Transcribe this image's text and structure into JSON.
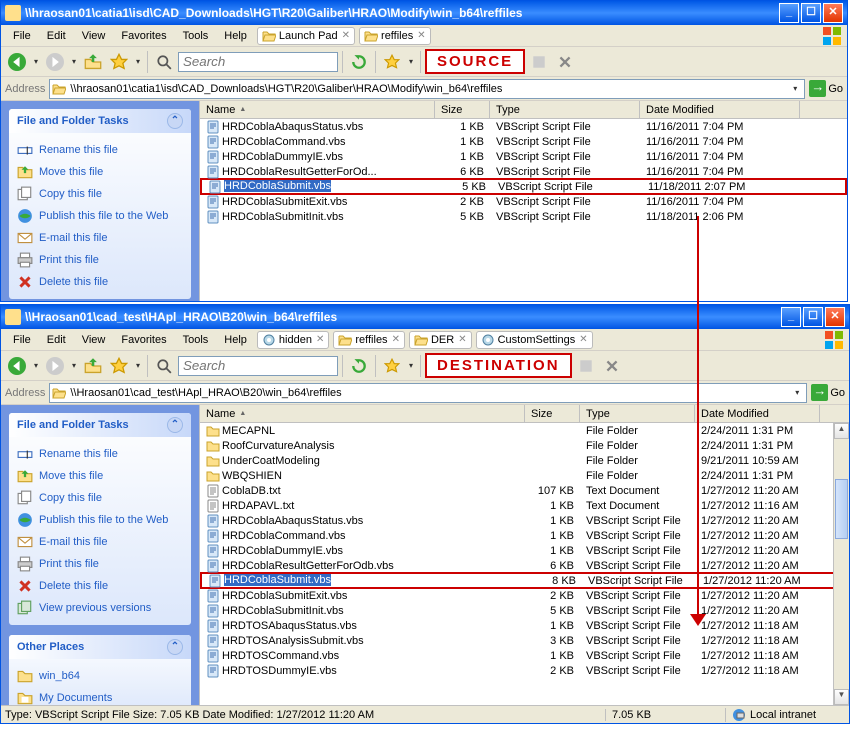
{
  "annotation_source": "SOURCE",
  "annotation_dest": "DESTINATION",
  "top_window": {
    "title": "\\\\hraosan01\\catia1\\isd\\CAD_Downloads\\HGT\\R20\\Galiber\\HRAO\\Modify\\win_b64\\reffiles",
    "menubar": [
      "File",
      "Edit",
      "View",
      "Favorites",
      "Tools",
      "Help"
    ],
    "tabs": [
      {
        "label": "Launch Pad",
        "icon": "folder"
      },
      {
        "label": "reffiles",
        "icon": "folder"
      }
    ],
    "search_placeholder": "Search",
    "address_label": "Address",
    "address_path": "\\\\hraosan01\\catia1\\isd\\CAD_Downloads\\HGT\\R20\\Galiber\\HRAO\\Modify\\win_b64\\reffiles",
    "go_label": "Go",
    "sidebar_title": "File and Folder Tasks",
    "sidebar_tasks": [
      {
        "icon": "rename",
        "label": "Rename this file"
      },
      {
        "icon": "move",
        "label": "Move this file"
      },
      {
        "icon": "copy",
        "label": "Copy this file"
      },
      {
        "icon": "publish",
        "label": "Publish this file to the Web"
      },
      {
        "icon": "email",
        "label": "E-mail this file"
      },
      {
        "icon": "print",
        "label": "Print this file"
      },
      {
        "icon": "delete",
        "label": "Delete this file"
      }
    ],
    "columns": [
      "Name",
      "Size",
      "Type",
      "Date Modified"
    ],
    "files": [
      {
        "name": "HRDCoblaAbaqusStatus.vbs",
        "size": "1 KB",
        "type": "VBScript Script File",
        "date": "11/16/2011 7:04 PM",
        "icon": "vbs",
        "sel": false
      },
      {
        "name": "HRDCoblaCommand.vbs",
        "size": "1 KB",
        "type": "VBScript Script File",
        "date": "11/16/2011 7:04 PM",
        "icon": "vbs",
        "sel": false
      },
      {
        "name": "HRDCoblaDummyIE.vbs",
        "size": "1 KB",
        "type": "VBScript Script File",
        "date": "11/16/2011 7:04 PM",
        "icon": "vbs",
        "sel": false
      },
      {
        "name": "HRDCoblaResultGetterForOd...",
        "size": "6 KB",
        "type": "VBScript Script File",
        "date": "11/16/2011 7:04 PM",
        "icon": "vbs",
        "sel": false
      },
      {
        "name": "HRDCoblaSubmit.vbs",
        "size": "5 KB",
        "type": "VBScript Script File",
        "date": "11/18/2011 2:07 PM",
        "icon": "vbs",
        "sel": true,
        "hl": true
      },
      {
        "name": "HRDCoblaSubmitExit.vbs",
        "size": "2 KB",
        "type": "VBScript Script File",
        "date": "11/16/2011 7:04 PM",
        "icon": "vbs",
        "sel": false
      },
      {
        "name": "HRDCoblaSubmitInit.vbs",
        "size": "5 KB",
        "type": "VBScript Script File",
        "date": "11/18/2011 2:06 PM",
        "icon": "vbs",
        "sel": false
      }
    ]
  },
  "bottom_window": {
    "title": "\\\\Hraosan01\\cad_test\\HApl_HRAO\\B20\\win_b64\\reffiles",
    "menubar": [
      "File",
      "Edit",
      "View",
      "Favorites",
      "Tools",
      "Help"
    ],
    "tabs": [
      {
        "label": "hidden",
        "icon": "gear"
      },
      {
        "label": "reffiles",
        "icon": "folder"
      },
      {
        "label": "DER",
        "icon": "folder"
      },
      {
        "label": "CustomSettings",
        "icon": "gear"
      }
    ],
    "search_placeholder": "Search",
    "address_label": "Address",
    "address_path": "\\\\Hraosan01\\cad_test\\HApl_HRAO\\B20\\win_b64\\reffiles",
    "go_label": "Go",
    "sidebar_title": "File and Folder Tasks",
    "sidebar_tasks": [
      {
        "icon": "rename",
        "label": "Rename this file"
      },
      {
        "icon": "move",
        "label": "Move this file"
      },
      {
        "icon": "copy",
        "label": "Copy this file"
      },
      {
        "icon": "publish",
        "label": "Publish this file to the Web"
      },
      {
        "icon": "email",
        "label": "E-mail this file"
      },
      {
        "icon": "print",
        "label": "Print this file"
      },
      {
        "icon": "delete",
        "label": "Delete this file"
      },
      {
        "icon": "versions",
        "label": "View previous versions"
      }
    ],
    "sidebar2_title": "Other Places",
    "sidebar2_items": [
      {
        "icon": "folder",
        "label": "win_b64"
      },
      {
        "icon": "docs",
        "label": "My Documents"
      }
    ],
    "columns": [
      "Name",
      "Size",
      "Type",
      "Date Modified"
    ],
    "files": [
      {
        "name": "MECAPNL",
        "size": "",
        "type": "File Folder",
        "date": "2/24/2011 1:31 PM",
        "icon": "folder",
        "sel": false
      },
      {
        "name": "RoofCurvatureAnalysis",
        "size": "",
        "type": "File Folder",
        "date": "2/24/2011 1:31 PM",
        "icon": "folder",
        "sel": false
      },
      {
        "name": "UnderCoatModeling",
        "size": "",
        "type": "File Folder",
        "date": "9/21/2011 10:59 AM",
        "icon": "folder",
        "sel": false
      },
      {
        "name": "WBQSHIEN",
        "size": "",
        "type": "File Folder",
        "date": "2/24/2011 1:31 PM",
        "icon": "folder",
        "sel": false
      },
      {
        "name": "CoblaDB.txt",
        "size": "107 KB",
        "type": "Text Document",
        "date": "1/27/2012 11:20 AM",
        "icon": "txt",
        "sel": false
      },
      {
        "name": "HRDAPAVL.txt",
        "size": "1 KB",
        "type": "Text Document",
        "date": "1/27/2012 11:16 AM",
        "icon": "txt",
        "sel": false
      },
      {
        "name": "HRDCoblaAbaqusStatus.vbs",
        "size": "1 KB",
        "type": "VBScript Script File",
        "date": "1/27/2012 11:20 AM",
        "icon": "vbs",
        "sel": false
      },
      {
        "name": "HRDCoblaCommand.vbs",
        "size": "1 KB",
        "type": "VBScript Script File",
        "date": "1/27/2012 11:20 AM",
        "icon": "vbs",
        "sel": false
      },
      {
        "name": "HRDCoblaDummyIE.vbs",
        "size": "1 KB",
        "type": "VBScript Script File",
        "date": "1/27/2012 11:20 AM",
        "icon": "vbs",
        "sel": false
      },
      {
        "name": "HRDCoblaResultGetterForOdb.vbs",
        "size": "6 KB",
        "type": "VBScript Script File",
        "date": "1/27/2012 11:20 AM",
        "icon": "vbs",
        "sel": false
      },
      {
        "name": "HRDCoblaSubmit.vbs",
        "size": "8 KB",
        "type": "VBScript Script File",
        "date": "1/27/2012 11:20 AM",
        "icon": "vbs",
        "sel": true,
        "hl": true
      },
      {
        "name": "HRDCoblaSubmitExit.vbs",
        "size": "2 KB",
        "type": "VBScript Script File",
        "date": "1/27/2012 11:20 AM",
        "icon": "vbs",
        "sel": false
      },
      {
        "name": "HRDCoblaSubmitInit.vbs",
        "size": "5 KB",
        "type": "VBScript Script File",
        "date": "1/27/2012 11:20 AM",
        "icon": "vbs",
        "sel": false
      },
      {
        "name": "HRDTOSAbaqusStatus.vbs",
        "size": "1 KB",
        "type": "VBScript Script File",
        "date": "1/27/2012 11:18 AM",
        "icon": "vbs",
        "sel": false
      },
      {
        "name": "HRDTOSAnalysisSubmit.vbs",
        "size": "3 KB",
        "type": "VBScript Script File",
        "date": "1/27/2012 11:18 AM",
        "icon": "vbs",
        "sel": false
      },
      {
        "name": "HRDTOSCommand.vbs",
        "size": "1 KB",
        "type": "VBScript Script File",
        "date": "1/27/2012 11:18 AM",
        "icon": "vbs",
        "sel": false
      },
      {
        "name": "HRDTOSDummyIE.vbs",
        "size": "2 KB",
        "type": "VBScript Script File",
        "date": "1/27/2012 11:18 AM",
        "icon": "vbs",
        "sel": false
      }
    ],
    "status_left": "Type: VBScript Script File Size: 7.05 KB Date Modified: 1/27/2012 11:20 AM",
    "status_mid": "7.05 KB",
    "status_right": "Local intranet"
  }
}
